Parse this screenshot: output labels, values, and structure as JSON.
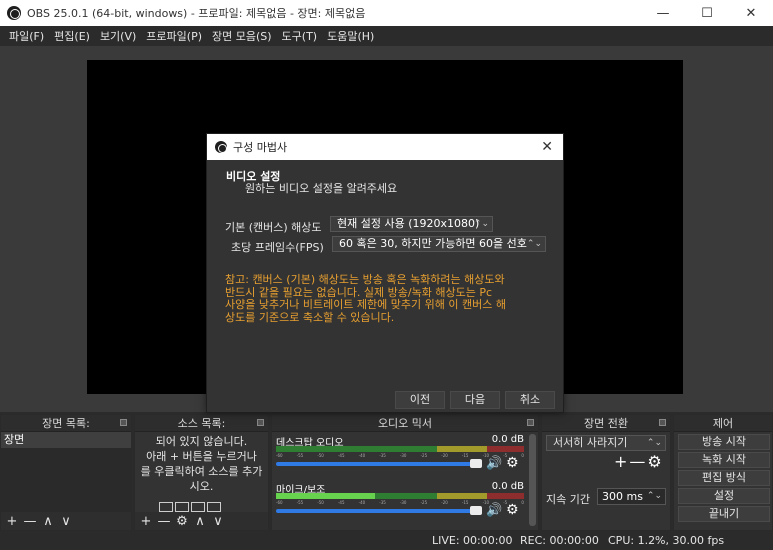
{
  "window": {
    "title": "OBS 25.0.1 (64-bit, windows) - 프로파일: 제목없음 - 장면: 제목없음",
    "minimize": "—",
    "maximize": "☐",
    "close": "✕"
  },
  "menu": [
    "파일(F)",
    "편집(E)",
    "보기(V)",
    "프로파일(P)",
    "장면 모음(S)",
    "도구(T)",
    "도움말(H)"
  ],
  "scenes": {
    "header": "장면 목록:",
    "items": [
      "장면"
    ],
    "tools": [
      "+",
      "—",
      "∧",
      "∨"
    ]
  },
  "sources": {
    "header": "소스 목록:",
    "empty_lines": [
      "되어 있지 않습니다.",
      "아래 + 버튼을 누르거나",
      "를 우클릭하여 소스를 추가",
      "시오."
    ],
    "tools": [
      "+",
      "—",
      "⚙",
      "∧",
      "∨"
    ]
  },
  "mixer": {
    "header": "오디오 믹서",
    "tracks": [
      {
        "name": "데스크탑 오디오",
        "db": "0.0 dB",
        "level": 0.0
      },
      {
        "name": "마이크/보조",
        "db": "0.0 dB",
        "level": 0.4
      }
    ],
    "speaker_icon": "speaker-icon",
    "gear_icon": "gear-icon"
  },
  "transitions": {
    "header": "장면 전환",
    "selected": "서서히 사라지기",
    "add": "+",
    "remove": "—",
    "settings": "⚙",
    "duration_label": "지속 기간",
    "duration_value": "300 ms"
  },
  "controls": {
    "header": "제어",
    "buttons": [
      "방송 시작",
      "녹화 시작",
      "편집 방식",
      "설정",
      "끝내기"
    ]
  },
  "status": {
    "live": "LIVE: 00:00:00",
    "rec": "REC: 00:00:00",
    "cpu": "CPU: 1.2%, 30.00 fps"
  },
  "wizard": {
    "title": "구성 마법사",
    "close": "✕",
    "heading": "비디오 설정",
    "subheading": "원하는 비디오 설정을 알려주세요",
    "resolution_label": "기본 (캔버스) 해상도",
    "resolution_value": "현재 설정 사용 (1920x1080)",
    "fps_label": "초당 프레임수(FPS)",
    "fps_value": "60 혹은 30, 하지만 가능하면 60을 선호",
    "notice_lines": [
      "참고: 캔버스 (기본) 해상도는 방송 혹은 녹화하려는 해상도와",
      "반드시 같을 필요는 없습니다. 실제 방송/녹화 해상도는 Pc",
      "사양을 낮추거나 비트레이트 제한에 맞추기 위해 이 캔버스 해",
      "상도를 기준으로 축소할 수 있습니다."
    ],
    "prev": "이전",
    "next": "다음",
    "cancel": "취소"
  },
  "colors": {
    "accent": "#2f7ae5",
    "notice": "#e8a030"
  }
}
